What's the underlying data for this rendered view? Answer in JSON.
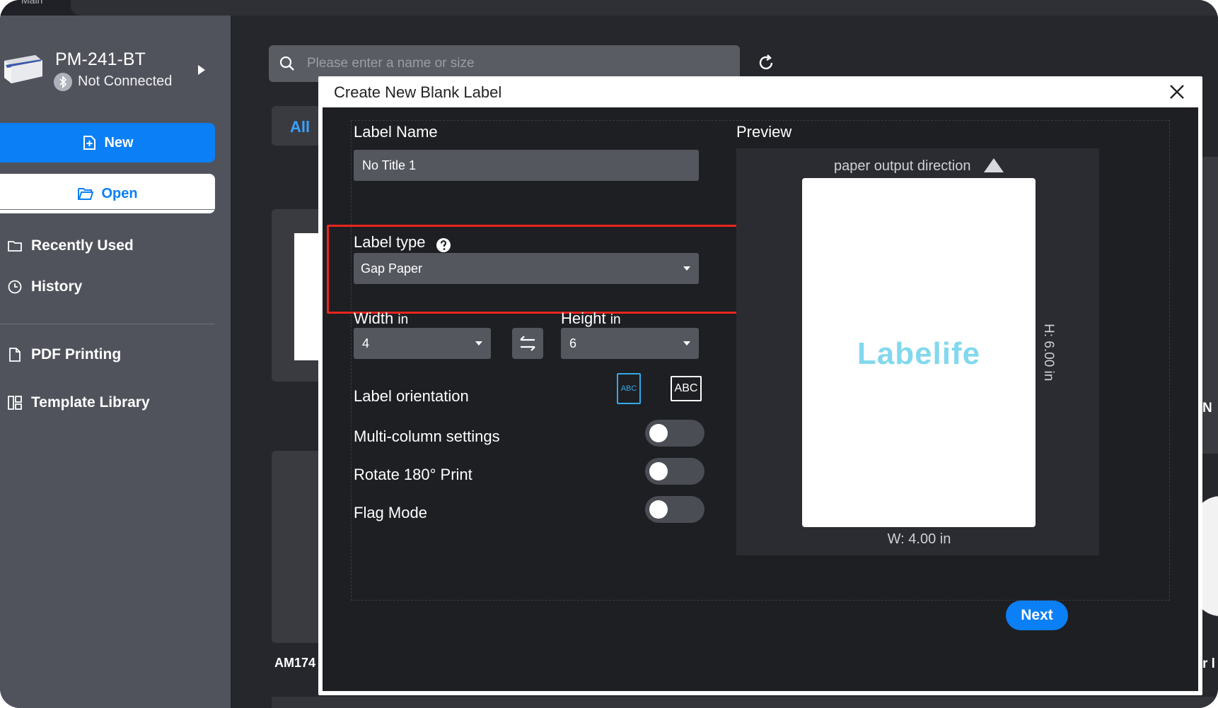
{
  "window": {
    "title": "Main"
  },
  "sidebar": {
    "printer": {
      "name": "PM-241-BT",
      "status": "Not Connected"
    },
    "new_label": "New",
    "open_label": "Open",
    "items": [
      {
        "label": "Recently Used",
        "icon": "folder-icon"
      },
      {
        "label": "History",
        "icon": "clock-icon"
      },
      {
        "label": "PDF Printing",
        "icon": "file-icon"
      },
      {
        "label": "Template Library",
        "icon": "template-icon"
      }
    ]
  },
  "main": {
    "search_placeholder": "Please enter a name or size",
    "tab_all": "All",
    "card_label": "AM174",
    "right_text_1": "N",
    "right_text_2": "r l"
  },
  "dialog": {
    "title": "Create New Blank Label",
    "label_name_label": "Label Name",
    "label_name_value": "No Title 1",
    "label_type_label": "Label type",
    "label_type_value": "Gap Paper",
    "width_label": "Width",
    "width_unit": "in",
    "width_value": "4",
    "height_label": "Height",
    "height_unit": "in",
    "height_value": "6",
    "orientation_label": "Label orientation",
    "orientation_options": [
      "ABC",
      "ABC"
    ],
    "orientation_selected": "portrait",
    "multi_column_label": "Multi-column settings",
    "multi_column_on": false,
    "rotate_label": "Rotate 180° Print",
    "rotate_on": false,
    "flag_label": "Flag Mode",
    "flag_on": false,
    "preview_title": "Preview",
    "paper_output_direction": "paper output direction",
    "brand": "Labelife",
    "dim_height": "H: 6.00 in",
    "dim_width": "W: 4.00 in",
    "next_label": "Next"
  },
  "colors": {
    "accent": "#0b7ff5",
    "highlight": "#e8251f",
    "sidebar": "#51535c",
    "dialog_bg": "#1e1f23",
    "brand": "#82d8ee"
  }
}
